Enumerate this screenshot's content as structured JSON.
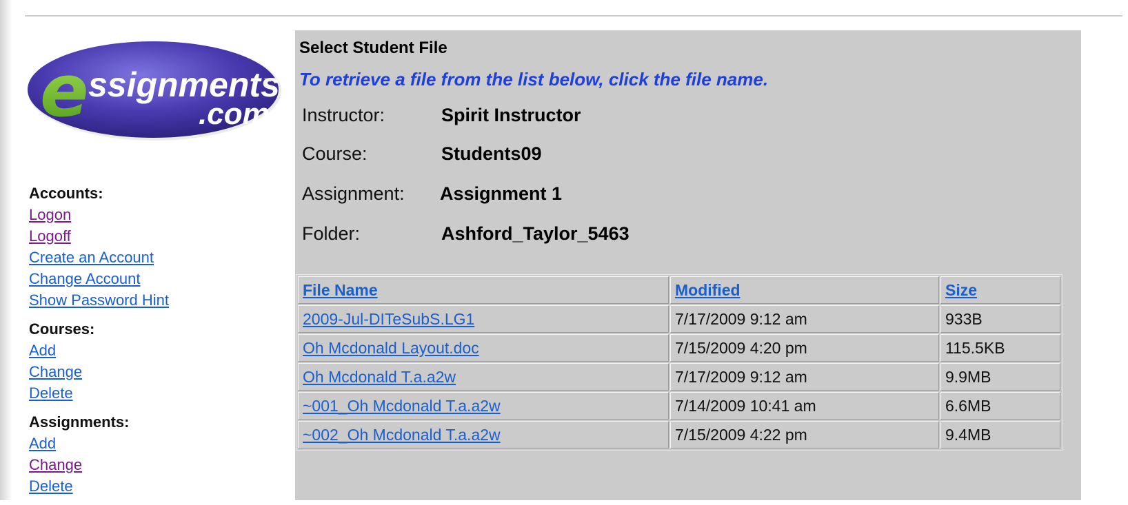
{
  "logo": {
    "letter": "e",
    "word": "ssignments",
    "tm": "™",
    "domain": ".com"
  },
  "sidebar": {
    "sections": [
      {
        "heading": "Accounts:",
        "links": [
          {
            "label": "Logon",
            "visited": true
          },
          {
            "label": "Logoff",
            "visited": true
          },
          {
            "label": "Create an Account",
            "visited": false
          },
          {
            "label": "Change Account",
            "visited": false
          },
          {
            "label": "Show Password Hint",
            "visited": false
          }
        ]
      },
      {
        "heading": "Courses:",
        "links": [
          {
            "label": "Add",
            "visited": false
          },
          {
            "label": "Change",
            "visited": false
          },
          {
            "label": "Delete",
            "visited": false
          }
        ]
      },
      {
        "heading": "Assignments:",
        "links": [
          {
            "label": "Add",
            "visited": false
          },
          {
            "label": "Change",
            "visited": true
          },
          {
            "label": "Delete",
            "visited": false
          }
        ]
      }
    ]
  },
  "main": {
    "title": "Select Student File",
    "instructions": "To retrieve a file from the list below, click the file name.",
    "instructor_label": "Instructor:",
    "instructor_value": "Spirit Instructor",
    "course_label": "Course:",
    "course_value": "Students09",
    "assignment_label": "Assignment:",
    "assignment_value": "Assignment 1",
    "folder_label": "Folder:",
    "folder_value": "Ashford_Taylor_5463"
  },
  "table": {
    "headers": [
      "File Name",
      "Modified",
      "Size"
    ],
    "rows": [
      [
        "2009-Jul-DITeSubS.LG1",
        "7/17/2009 9:12 am",
        "933B"
      ],
      [
        "Oh Mcdonald Layout.doc",
        "7/15/2009 4:20 pm",
        "115.5KB"
      ],
      [
        "Oh Mcdonald T.a.a2w",
        "7/17/2009 9:12 am",
        "9.9MB"
      ],
      [
        "~001_Oh Mcdonald T.a.a2w",
        "7/14/2009 10:41 am",
        "6.6MB"
      ],
      [
        "~002_Oh Mcdonald T.a.a2w",
        "7/15/2009 4:22 pm",
        "9.4MB"
      ]
    ]
  },
  "colors": {
    "panel_bg": "#cbcbcb",
    "instructions": "#1e3fe0",
    "link": "#1a5fd0",
    "visited_link": "#7a1a8a",
    "logo_oval": "#4a3ab0",
    "logo_e": "#6dbf2a"
  }
}
